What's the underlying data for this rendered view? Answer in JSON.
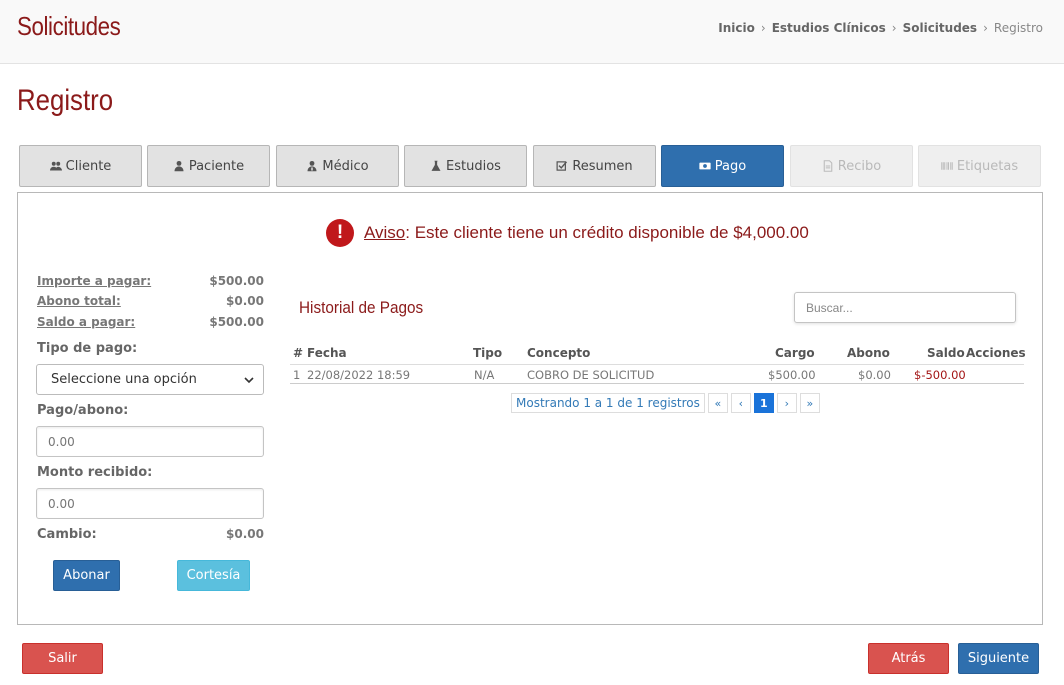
{
  "header": {
    "app_title": "Solicitudes",
    "breadcrumb": [
      "Inicio",
      "Estudios Clínicos",
      "Solicitudes",
      "Registro"
    ]
  },
  "page_title": "Registro",
  "tabs": [
    {
      "label": "Cliente",
      "icon": "users-icon",
      "state": "default"
    },
    {
      "label": "Paciente",
      "icon": "user-icon",
      "state": "default"
    },
    {
      "label": "Médico",
      "icon": "doctor-icon",
      "state": "default"
    },
    {
      "label": "Estudios",
      "icon": "flask-icon",
      "state": "default"
    },
    {
      "label": "Resumen",
      "icon": "check-square-icon",
      "state": "default"
    },
    {
      "label": "Pago",
      "icon": "money-icon",
      "state": "active"
    },
    {
      "label": "Recibo",
      "icon": "file-icon",
      "state": "disabled"
    },
    {
      "label": "Etiquetas",
      "icon": "barcode-icon",
      "state": "disabled"
    }
  ],
  "notice": {
    "label": "Aviso",
    "text": ": Este cliente tiene un crédito disponible de $4,000.00"
  },
  "summary": {
    "importe_label": "Importe a pagar:",
    "importe_value": "$500.00",
    "abono_label": "Abono total:",
    "abono_value": "$0.00",
    "saldo_label": "Saldo a pagar:",
    "saldo_value": "$500.00"
  },
  "form": {
    "tipo_pago_label": "Tipo de pago:",
    "tipo_pago_value": "Seleccione una opción",
    "pago_abono_label": "Pago/abono:",
    "pago_abono_placeholder": "0.00",
    "monto_recibido_label": "Monto recibido:",
    "monto_recibido_placeholder": "0.00",
    "cambio_label": "Cambio:",
    "cambio_value": "$0.00",
    "abonar_button": "Abonar",
    "cortesia_button": "Cortesía"
  },
  "history": {
    "title": "Historial de Pagos",
    "search_placeholder": "Buscar...",
    "columns": [
      "#",
      "Fecha",
      "Tipo",
      "Concepto",
      "Cargo",
      "Abono",
      "Saldo",
      "Acciones"
    ],
    "rows": [
      [
        "1",
        "22/08/2022 18:59",
        "N/A",
        "COBRO DE SOLICITUD",
        "$500.00",
        "$0.00",
        "$-500.00",
        ""
      ]
    ],
    "pagination_info": "Mostrando 1 a 1 de 1 registros",
    "pages": [
      "«",
      "‹",
      "1",
      "›",
      "»"
    ]
  },
  "footer": {
    "salir_button": "Salir",
    "atras_button": "Atrás",
    "siguiente_button": "Siguiente"
  },
  "colors": {
    "brand_red": "#8b1a1a",
    "primary_blue": "#2f6fae",
    "danger_red": "#d9534f",
    "info_cyan": "#5bc0de"
  }
}
